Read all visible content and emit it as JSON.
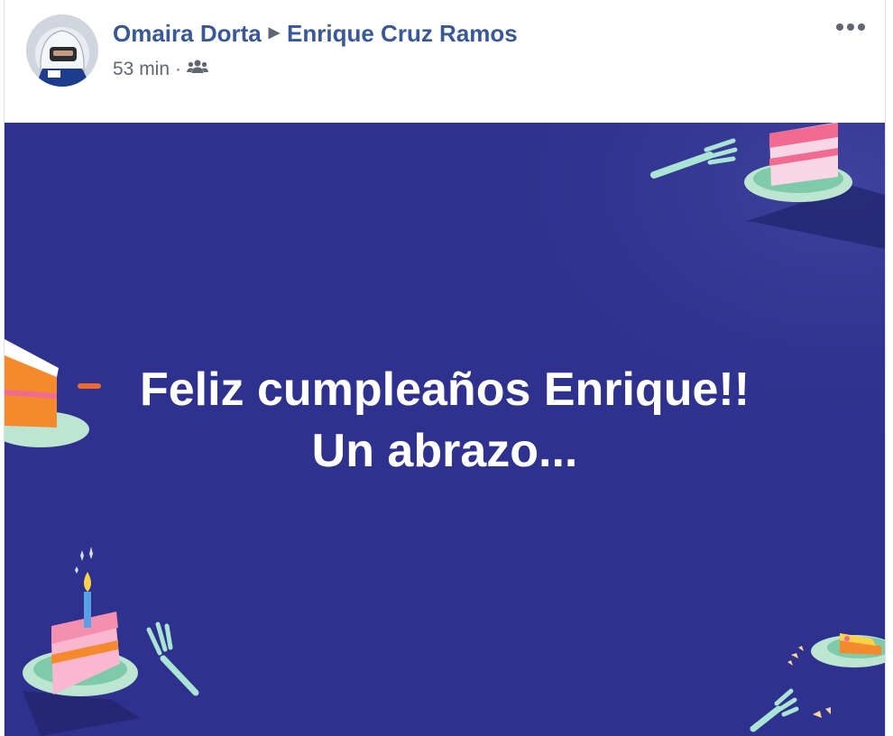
{
  "post": {
    "author": "Omaira Dorta",
    "target": "Enrique Cruz Ramos",
    "time": "53 min",
    "separator": "·",
    "audience_icon": "friends-icon",
    "more_icon": "more-options-icon"
  },
  "banner": {
    "line1": "Feliz cumpleaños Enrique!!",
    "line2": "Un abrazo...",
    "background": "#2e318d",
    "text_color": "#ffffff"
  },
  "colors": {
    "name_link": "#385898",
    "meta_text": "#616770"
  }
}
